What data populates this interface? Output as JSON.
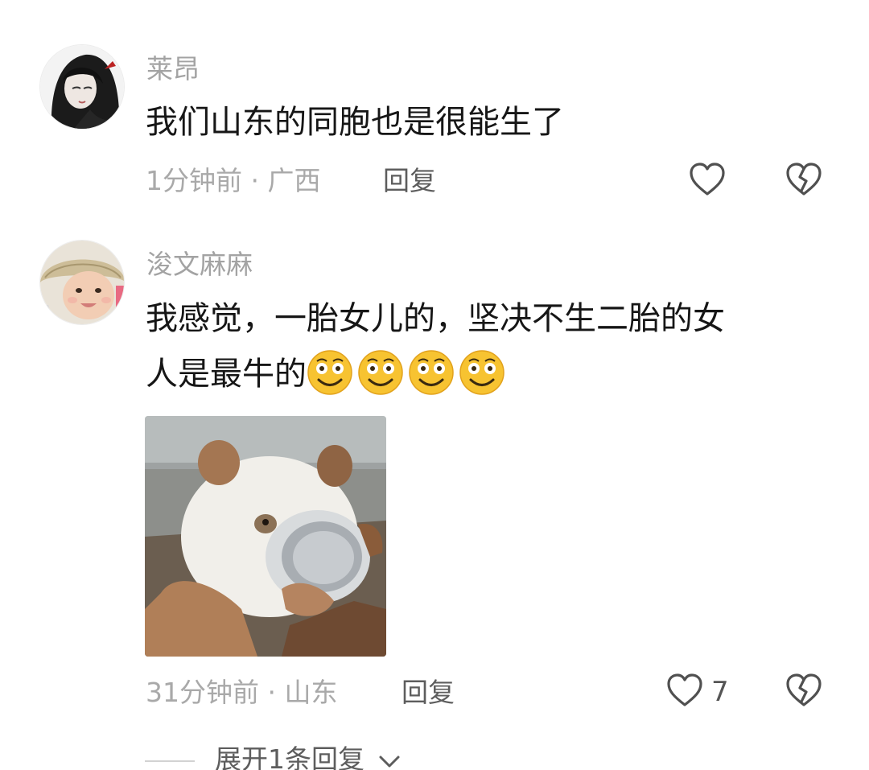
{
  "comments": [
    {
      "username": "莱昂",
      "text": "我们山东的同胞也是很能生了",
      "meta": "1分钟前 · 广西",
      "reply_label": "回复"
    },
    {
      "username": "浚文麻麻",
      "text_line1": "我感觉，一胎女儿的，坚决不生二胎的女",
      "text_line2": "人是最牛的",
      "emoji": [
        "smiley-emoji",
        "smiley-emoji",
        "smiley-emoji",
        "smiley-emoji"
      ],
      "meta": "31分钟前 · 山东",
      "reply_label": "回复",
      "like_count": "7"
    }
  ],
  "expand_replies": "展开1条回复",
  "icons": {
    "like": "heart-outline-icon",
    "dislike": "broken-heart-icon",
    "expand": "chevron-down-icon"
  },
  "colors": {
    "username": "#a3a3a3",
    "meta": "#a9a9a9",
    "content": "#161616",
    "emoji": "#f7c331"
  }
}
